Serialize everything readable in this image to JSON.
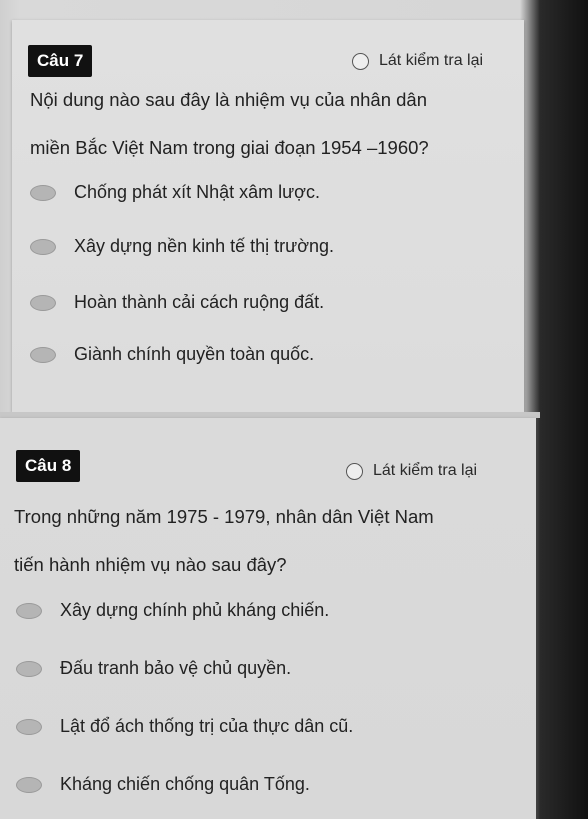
{
  "question7": {
    "badge": "Câu 7",
    "review_label": "Lát kiểm tra lại",
    "text_line1": "Nội dung nào sau đây là nhiệm vụ của nhân dân",
    "text_line2": "miền Bắc Việt Nam trong giai đoạn 1954 –1960?",
    "options": [
      "Chống phát xít Nhật xâm lược.",
      "Xây dựng nền kinh tế thị trường.",
      "Hoàn thành cải cách ruộng đất.",
      "Giành chính quyền toàn quốc."
    ]
  },
  "question8": {
    "badge": "Câu 8",
    "review_label": "Lát kiểm tra lại",
    "text_line1": "Trong những năm 1975 - 1979, nhân dân Việt Nam",
    "text_line2": "tiến hành nhiệm vụ nào sau đây?",
    "options": [
      "Xây dựng chính phủ kháng chiến.",
      "Đấu tranh bảo vệ chủ quyền.",
      "Lật đổ ách thống trị của thực dân cũ.",
      "Kháng chiến chống quân Tống."
    ]
  }
}
